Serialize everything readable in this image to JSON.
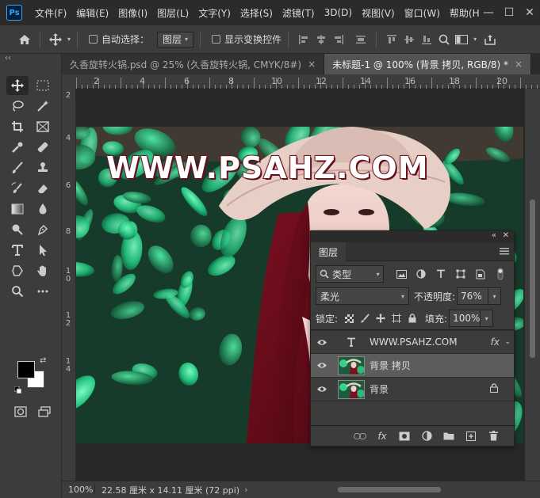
{
  "app": {
    "logo": "Ps"
  },
  "menu": [
    "文件(F)",
    "编辑(E)",
    "图像(I)",
    "图层(L)",
    "文字(Y)",
    "选择(S)",
    "滤镜(T)",
    "3D(D)",
    "视图(V)",
    "窗口(W)",
    "帮助(H"
  ],
  "window_controls": {
    "minimize": "—",
    "maximize": "☐",
    "close": "✕"
  },
  "options": {
    "auto_select_label": "自动选择：",
    "auto_select_value": "图层",
    "show_transform_label": "显示变换控件"
  },
  "tabs": [
    {
      "label": "久香旋转火锅.psd @ 25% (久香旋转火锅, CMYK/8#)",
      "close": "×"
    },
    {
      "label": "未标题-1 @ 100% (背景 拷贝, RGB/8) *",
      "close": "×"
    }
  ],
  "ruler": {
    "h_labels": [
      "2",
      "4",
      "6",
      "8",
      "10",
      "12",
      "14",
      "16",
      "18",
      "20"
    ],
    "v_labels": [
      "2",
      "4",
      "6",
      "8",
      "10",
      "12",
      "14"
    ]
  },
  "canvas": {
    "watermark": "WWW.PSAHZ.COM"
  },
  "status": {
    "zoom": "100%",
    "doc_info": "22.58 厘米 x 14.11 厘米 (72 ppi)",
    "arrow": "›"
  },
  "layers_panel": {
    "top_controls": {
      "collapse": "«",
      "close": "✕"
    },
    "title": "图层",
    "filter_kind": "类型",
    "blend_mode": "柔光",
    "opacity_label": "不透明度:",
    "opacity_value": "76%",
    "lock_label": "锁定:",
    "fill_label": "填充:",
    "fill_value": "100%",
    "layers": [
      {
        "name": "WWW.PSAHZ.COM",
        "type": "text",
        "badge": "fx"
      },
      {
        "name": "背景 拷贝",
        "type": "image",
        "selected": true
      },
      {
        "name": "背景",
        "type": "image",
        "locked": true
      }
    ],
    "bottom": {
      "fx": "fx"
    }
  }
}
